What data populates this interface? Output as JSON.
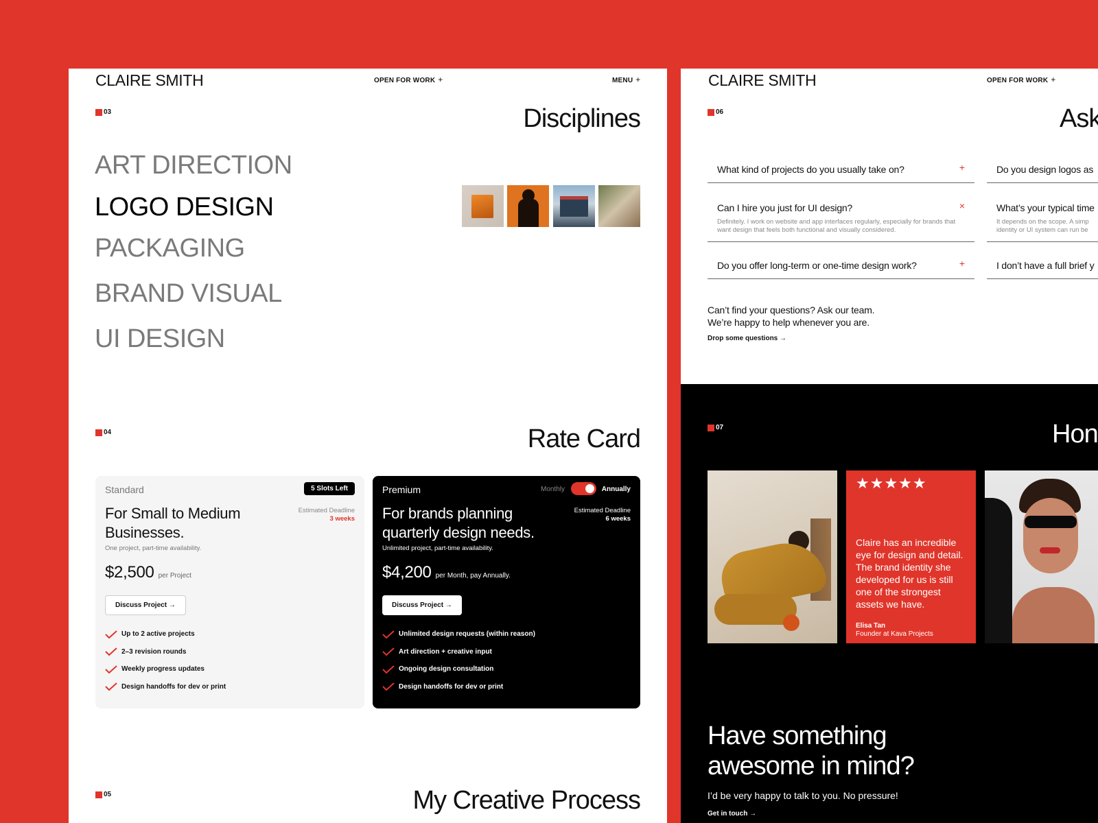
{
  "brand": "CLAIRE SMITH",
  "nav": {
    "open_for_work": "OPEN FOR WORK",
    "menu": "MENU",
    "plus": "+"
  },
  "disciplines": {
    "number": "03",
    "title": "Disciplines",
    "items": [
      "ART DIRECTION",
      "LOGO DESIGN",
      "PACKAGING",
      "BRAND VISUAL",
      "UI DESIGN"
    ],
    "active_index": 1
  },
  "rate_card": {
    "number": "04",
    "title": "Rate Card",
    "standard": {
      "tier": "Standard",
      "badge": "5 Slots Left",
      "headline_1": "For Small to Medium",
      "headline_2": "Businesses.",
      "sub": "One project, part-time availability.",
      "deadline_label": "Estimated Deadline",
      "deadline_value": "3 weeks",
      "price": "$2,500",
      "price_unit": "per Project",
      "cta": "Discuss Project →",
      "features": [
        "Up to 2 active projects",
        "2–3 revision rounds",
        "Weekly progress updates",
        "Design handoffs for dev or print"
      ]
    },
    "premium": {
      "tier": "Premium",
      "toggle_left": "Monthly",
      "toggle_right": "Annually",
      "headline_1": "For brands planning",
      "headline_2": "quarterly design needs.",
      "sub": "Unlimited project, part-time availability.",
      "deadline_label": "Estimated Deadline",
      "deadline_value": "6 weeks",
      "price": "$4,200",
      "price_unit": "per Month, pay Annually.",
      "cta": "Discuss Project →",
      "features": [
        "Unlimited design requests (within reason)",
        "Art direction + creative input",
        "Ongoing design consultation",
        "Design handoffs for dev or print"
      ]
    }
  },
  "process": {
    "number": "05",
    "title": "My Creative Process"
  },
  "faq": {
    "number": "06",
    "title": "Ask",
    "left": [
      {
        "q": "What kind of projects do you usually take on?",
        "icon": "+"
      },
      {
        "q": "Can I hire you just for UI design?",
        "icon": "×",
        "a": "Definitely. I work on website and app interfaces regularly, especially for brands that want design that feels both functional and visually considered."
      },
      {
        "q": "Do you offer long-term or one-time design work?",
        "icon": "+"
      }
    ],
    "right": [
      {
        "q": "Do you design logos as"
      },
      {
        "q": "What’s your typical time",
        "a1": "It depends on the scope. A simp",
        "a2": "identity or UI system can run be"
      },
      {
        "q": "I don’t have a full brief y"
      }
    ],
    "cta_line_1": "Can’t find your questions? Ask our team.",
    "cta_line_2": "We’re happy to help whenever you are.",
    "cta_link": "Drop some questions →"
  },
  "testimonials": {
    "number": "07",
    "title": "Hon",
    "stars": "★★★★★",
    "quote": "Claire has an incredible eye for design and detail. The brand identity she developed for us is still one of the strongest assets we have.",
    "author": "Elisa Tan",
    "role": "Founder at Kava Projects"
  },
  "contact": {
    "headline_1": "Have something",
    "headline_2": "awesome in mind?",
    "sub": "I’d be very happy to talk to you. No pressure!",
    "link": "Get in touch →"
  },
  "colors": {
    "accent": "#E0352B",
    "dark": "#000000",
    "card_light": "#F5F5F5"
  }
}
